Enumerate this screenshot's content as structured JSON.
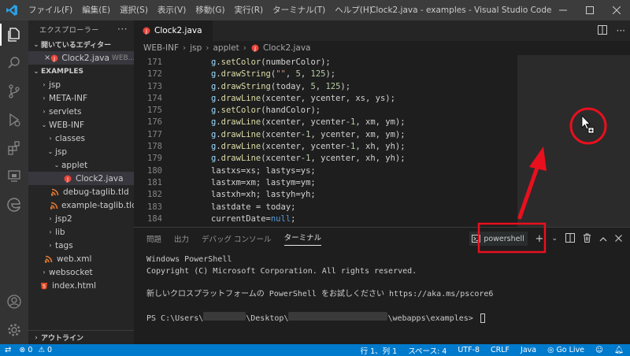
{
  "menubar": {
    "items": [
      "ファイル(F)",
      "編集(E)",
      "選択(S)",
      "表示(V)",
      "移動(G)",
      "実行(R)",
      "ターミナル(T)",
      "ヘルプ(H)"
    ],
    "window_title": "Clock2.java - examples - Visual Studio Code"
  },
  "activity": {
    "icons": [
      "explorer-icon",
      "search-icon",
      "source-control-icon",
      "run-debug-icon",
      "extensions-icon",
      "remote-icon",
      "edge-icon",
      "account-icon",
      "settings-gear-icon"
    ]
  },
  "sidebar": {
    "title": "エクスプローラー",
    "more": "···",
    "open_editors": "開いているエディター",
    "open_file": {
      "name": "Clock2.java",
      "path": "WEB..."
    },
    "workspace": "EXAMPLES",
    "tree": [
      "jsp",
      "META-INF",
      "servlets",
      "WEB-INF",
      "classes",
      "jsp",
      "applet",
      "Clock2.java",
      "debug-taglib.tld",
      "example-taglib.tld",
      "jsp2",
      "lib",
      "tags",
      "web.xml",
      "websocket",
      "index.html"
    ],
    "outline": "アウトライン"
  },
  "editor": {
    "tab_label": "Clock2.java",
    "breadcrumb": [
      "WEB-INF",
      "jsp",
      "applet",
      "Clock2.java"
    ],
    "line_numbers": [
      "171",
      "172",
      "173",
      "174",
      "175",
      "176",
      "177",
      "178",
      "179",
      "180",
      "181",
      "182",
      "183",
      "184"
    ],
    "code_lines": [
      "g.setColor(numberColor);",
      "g.drawString(\"\", 5, 125);",
      "g.drawString(today, 5, 125);",
      "g.drawLine(xcenter, ycenter, xs, ys);",
      "g.setColor(handColor);",
      "g.drawLine(xcenter, ycenter-1, xm, ym);",
      "g.drawLine(xcenter-1, ycenter, xm, ym);",
      "g.drawLine(xcenter, ycenter-1, xh, yh);",
      "g.drawLine(xcenter-1, ycenter, xh, yh);",
      "lastxs=xs; lastys=ys;",
      "lastxm=xm; lastym=ym;",
      "lastxh=xh; lastyh=yh;",
      "lastdate = today;",
      "currentDate=null;"
    ]
  },
  "panel": {
    "tabs": [
      "問題",
      "出力",
      "デバッグ コンソール",
      "ターミナル"
    ],
    "active_tab": "ターミナル",
    "shell_label": "powershell",
    "terminal_lines": [
      "Windows PowerShell",
      "Copyright (C) Microsoft Corporation. All rights reserved.",
      "",
      "新しいクロスプラットフォームの PowerShell をお試しください https://aka.ms/pscore6",
      ""
    ],
    "prompt": {
      "p1": "PS C:\\Users\\",
      "p2": "\\Desktop\\",
      "p3": "\\webapps\\examples> "
    }
  },
  "statusbar": {
    "errors": "0",
    "warnings": "0",
    "position": "行 1、列 1",
    "spaces": "スペース: 4",
    "encoding": "UTF-8",
    "eol": "CRLF",
    "language": "Java",
    "golive": "Go Live"
  },
  "colors": {
    "accent": "#007acc",
    "annotation": "#e8101e",
    "java_icon": "#e8453c"
  }
}
